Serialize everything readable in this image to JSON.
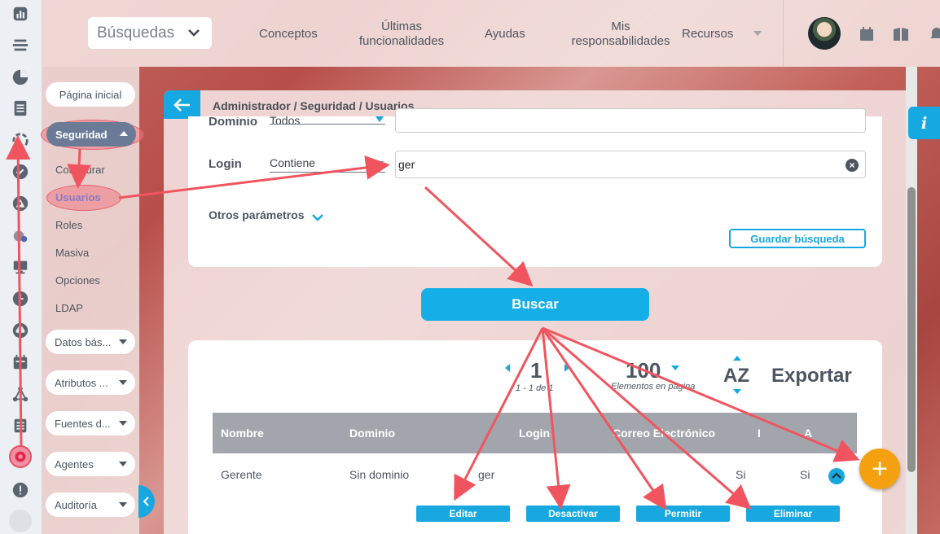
{
  "topbar": {
    "search_select": "Búsquedas",
    "nav": [
      "Conceptos",
      "Últimas funcionalidades",
      "Ayudas",
      "Mis responsabilidades",
      "Recursos"
    ]
  },
  "sidemenu": {
    "home": "Página inicial",
    "security": "Seguridad",
    "security_items": [
      "Configurar",
      "Usuarios",
      "Roles",
      "Masiva",
      "Opciones",
      "LDAP"
    ],
    "groups": [
      "Datos bás...",
      "Atributos ...",
      "Fuentes d...",
      "Agentes",
      "Auditoría"
    ]
  },
  "breadcrumb": "Administrador / Seguridad / Usuarios",
  "filters": {
    "dominio_label": "Dominio",
    "dominio_value": "Todos",
    "login_label": "Login",
    "login_operator": "Contiene",
    "login_value": "ger",
    "otros": "Otros parámetros",
    "save_search": "Guardar búsqueda"
  },
  "buscar_label": "Buscar",
  "pagination": {
    "page": "1",
    "range": "1 - 1 de 1",
    "per_page": "100",
    "per_page_label": "Elementos en página",
    "sort": "AZ",
    "export": "Exportar"
  },
  "table": {
    "columns": [
      "Nombre",
      "Dominio",
      "Login",
      "Correo Electrónico",
      "I",
      "A"
    ],
    "rows": [
      {
        "nombre": "Gerente",
        "dominio": "Sin dominio",
        "login": "ger",
        "correo": "",
        "i": "Si",
        "a": "Si"
      }
    ],
    "actions": [
      "Editar",
      "Desactivar",
      "Permitir",
      "Eliminar"
    ]
  },
  "fab_label": "+",
  "info_label": "i",
  "colors": {
    "accent": "#16a9e1",
    "fab": "#f5a010",
    "annotation": "#f0555f"
  }
}
